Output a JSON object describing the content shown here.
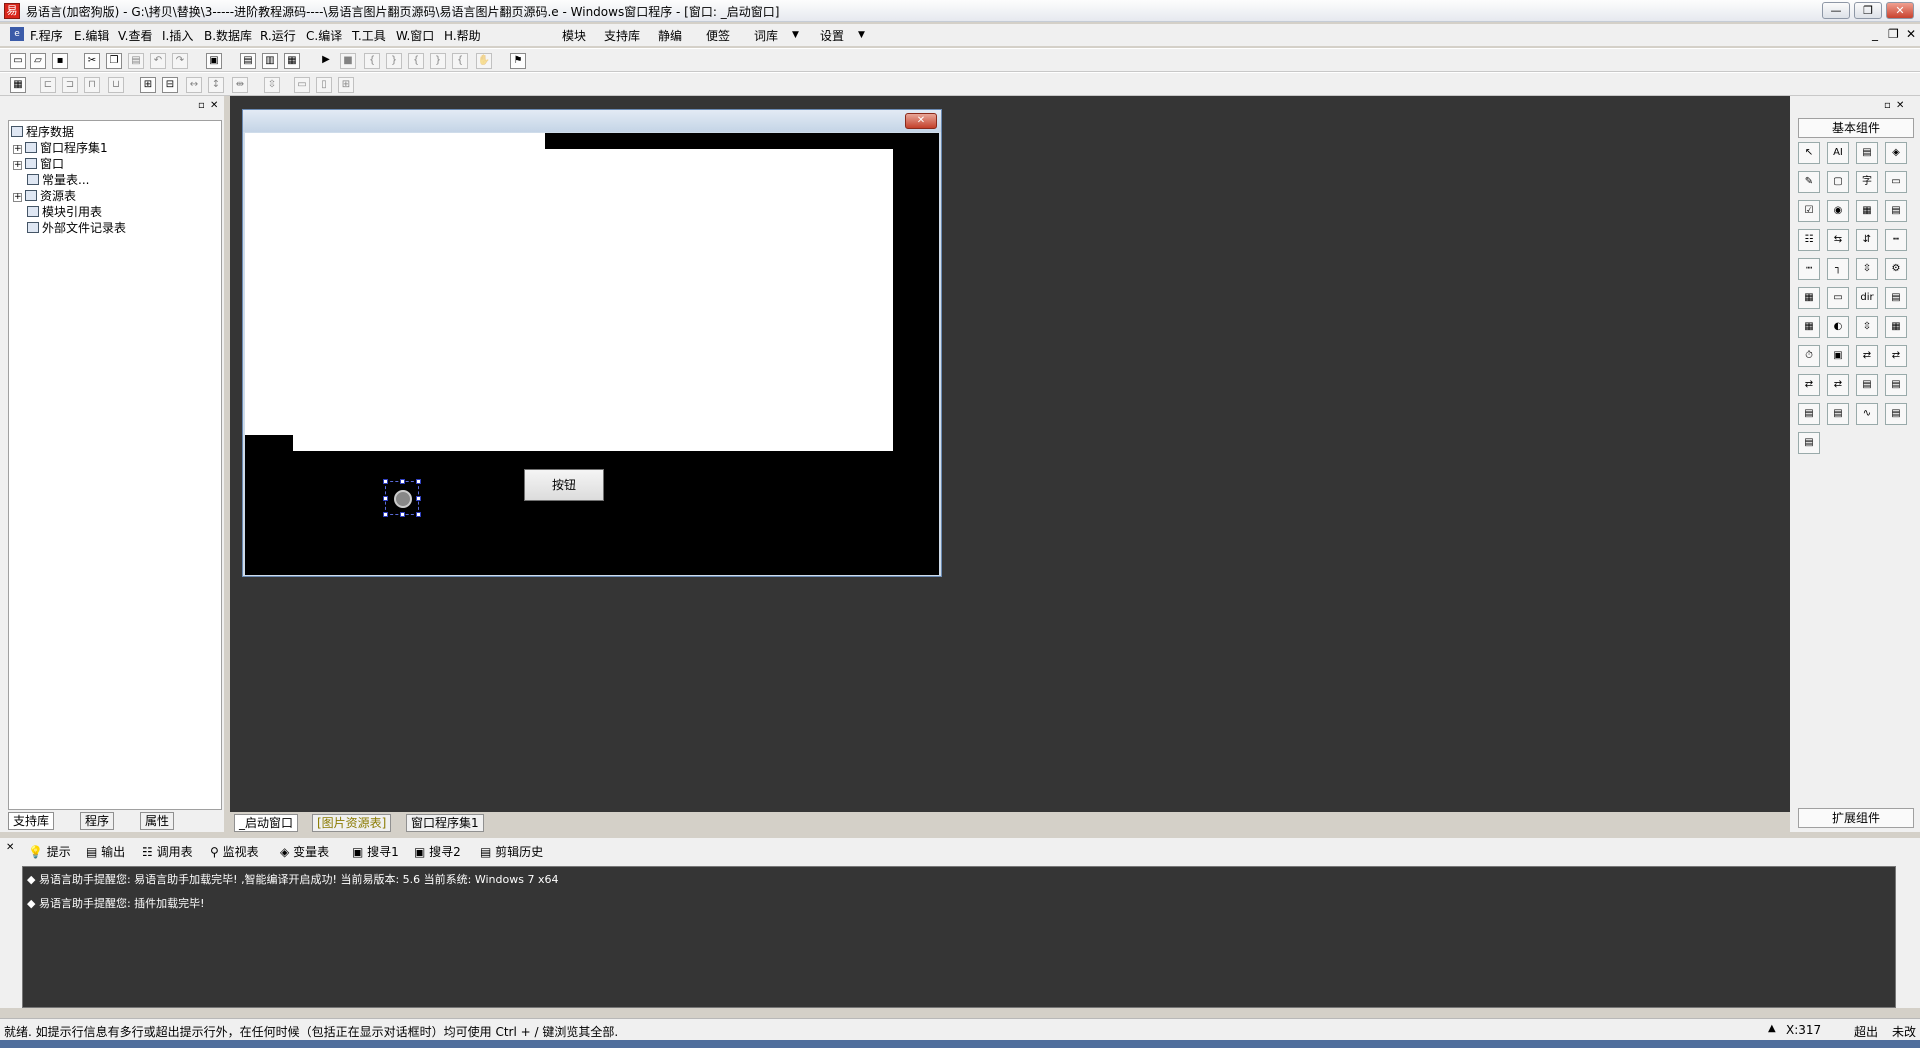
{
  "title_bar": {
    "title": "易语言(加密狗版) - G:\\拷贝\\替换\\3-----进阶教程源码----\\易语言图片翻页源码\\易语言图片翻页源码.e - Windows窗口程序 - [窗口: _启动窗口]",
    "logo": "易"
  },
  "window_buttons": {
    "minimize": "—",
    "restore": "❐",
    "close": "✕",
    "mdi_min": "_",
    "mdi_restore": "❐",
    "mdi_close": "✕"
  },
  "menu": {
    "items": [
      "F.程序",
      "E.编辑",
      "V.查看",
      "I.插入",
      "B.数据库",
      "R.运行",
      "C.编译",
      "T.工具",
      "W.窗口",
      "H.帮助"
    ],
    "extra": [
      "模块",
      "支持库",
      "静编",
      "便签",
      "词库",
      "设置"
    ],
    "dd": "▼"
  },
  "toolbar1": [
    "new-icon",
    "open-icon",
    "save-icon",
    "cut-icon",
    "copy-icon",
    "paste-icon",
    "undo-icon",
    "redo-icon",
    "preview-icon",
    "layout1-icon",
    "layout2-icon",
    "layout3-icon",
    "run-icon",
    "stop-icon",
    "step1-icon",
    "step2-icon",
    "step3-icon",
    "step4-icon",
    "step5-icon",
    "hand-icon",
    "debug-icon"
  ],
  "toolbar2": [
    "form-icon",
    "align-left-icon",
    "align-right-icon",
    "align-top-icon",
    "align-bottom-icon",
    "center-h-icon",
    "center-v-icon",
    "width-icon",
    "height-icon",
    "space-h-icon",
    "space-v-icon",
    "size-icon",
    "size2-icon",
    "grid-icon"
  ],
  "tree": {
    "root": "程序数据",
    "items": [
      "窗口程序集1",
      "窗口",
      "常量表...",
      "资源表",
      "模块引用表",
      "外部文件记录表"
    ]
  },
  "left_tabs": [
    "支持库",
    "程序",
    "属性"
  ],
  "editor_tabs": [
    "_启动窗口",
    "[图片资源表]",
    "窗口程序集1"
  ],
  "dialog": {
    "close_glyph": "✕",
    "button_label": "按钮"
  },
  "right_panel": {
    "title": "基本组件",
    "footer": "扩展组件",
    "controls": [
      "↖",
      "AI",
      "▤",
      "◈",
      "✎",
      "▢",
      "字",
      "▭",
      "☑",
      "◉",
      "▦",
      "▤",
      "☷",
      "⇆",
      "⇵",
      "┅",
      "┉",
      "┐",
      "⇳",
      "⚙",
      "▦",
      "▭",
      "dir",
      "▤",
      "▦",
      "◐",
      "⇳",
      "▦",
      "⏱",
      "▣",
      "⇄",
      "⇄",
      "⇄",
      "⇄",
      "▤",
      "▤",
      "▤",
      "▤",
      "∿",
      "▤",
      "▤"
    ]
  },
  "bottom_tabs": [
    "提示",
    "输出",
    "调用表",
    "监视表",
    "变量表",
    "搜寻1",
    "搜寻2",
    "剪辑历史"
  ],
  "output": [
    "◆ 易语言助手提醒您: 易语言助手加载完毕! ,智能编译开启成功! 当前易版本: 5.6 当前系统: Windows 7 x64",
    "◆ 易语言助手提醒您: 插件加载完毕!"
  ],
  "status": {
    "text": "就绪. 如提示行信息有多行或超出提示行外，在任何时候（包括正在显示对话框时）均可使用 Ctrl + / 键浏览其全部.",
    "coords": "X:317",
    "mode": "超出",
    "state": "未改"
  }
}
